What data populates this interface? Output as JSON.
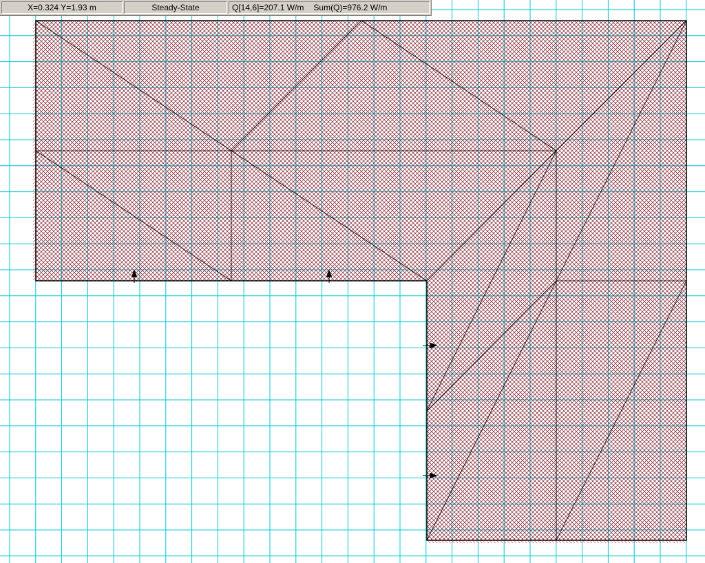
{
  "status_bar": {
    "coordinates": "X=0.324 Y=1.93 m",
    "mode": "Steady-State",
    "node_flux": "Q[14,6]=207.1 W/m",
    "total_flux": "Sum(Q)=976.2 W/m"
  },
  "colors": {
    "grid_line": "#00c8d2",
    "hatch": "#7a1a2a",
    "outline": "#000000",
    "boundary_tick": "#ff4444",
    "background": "#ffffff",
    "status_bar_bg": "#d4d0c8"
  },
  "icons": {
    "heat_flux_up": "arrow-up-icon",
    "heat_flux_right": "arrow-right-icon"
  }
}
